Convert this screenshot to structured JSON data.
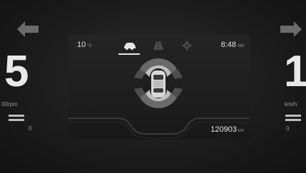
{
  "left_cluster": {
    "gear_digit": "5",
    "rpm_unit": "00rpm",
    "scale_zero": "0"
  },
  "right_cluster": {
    "speed_digit": "1",
    "speed_unit": "km/h",
    "scale_zero": "0"
  },
  "screen": {
    "temperature": "10",
    "temperature_unit": "°C",
    "tabs": [
      {
        "icon": "car-icon",
        "active": true
      },
      {
        "icon": "road-icon",
        "active": false
      },
      {
        "icon": "gear-icon",
        "active": false
      }
    ],
    "time": "8:48",
    "time_suffix": "AM",
    "odometer": "120903",
    "odometer_unit": "km"
  },
  "colors": {
    "accent": "#e6e6e6",
    "sensor_dim": "#6a6a6a",
    "sensor_bright": "#bfbfbf"
  }
}
